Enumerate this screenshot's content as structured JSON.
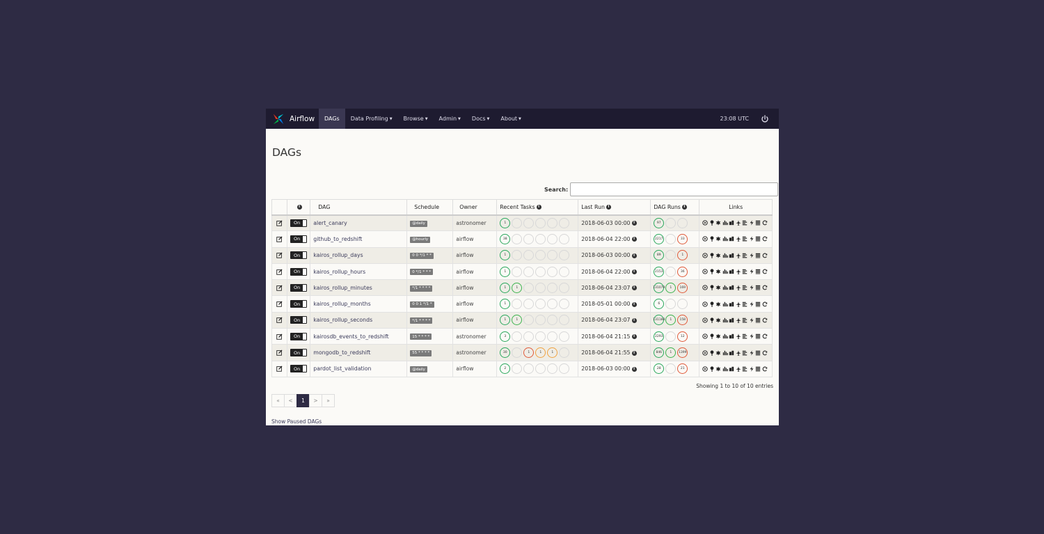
{
  "navbar": {
    "brand": "Airflow",
    "items": [
      {
        "label": "DAGs",
        "dropdown": false,
        "active": true
      },
      {
        "label": "Data Profiling",
        "dropdown": true
      },
      {
        "label": "Browse",
        "dropdown": true
      },
      {
        "label": "Admin",
        "dropdown": true
      },
      {
        "label": "Docs",
        "dropdown": true
      },
      {
        "label": "About",
        "dropdown": true
      }
    ],
    "clock": "23:08 UTC",
    "power_icon": "power-icon"
  },
  "page": {
    "title": "DAGs",
    "search_label": "Search:",
    "search_value": ""
  },
  "table": {
    "headers": [
      "",
      "",
      "DAG",
      "Schedule",
      "Owner",
      "Recent Tasks",
      "Last Run",
      "DAG Runs",
      "Links"
    ],
    "toggle_label": "On",
    "rows": [
      {
        "dag": "alert_canary",
        "schedule": "@daily",
        "owner": "astronomer",
        "tasks": [
          {
            "s": "success",
            "v": "1"
          },
          {
            "s": "",
            "v": ""
          },
          {
            "s": "",
            "v": ""
          },
          {
            "s": "",
            "v": ""
          },
          {
            "s": "",
            "v": ""
          },
          {
            "s": "",
            "v": ""
          }
        ],
        "last_run": "2018-06-03 00:00",
        "runs": [
          {
            "s": "success",
            "v": "97"
          },
          {
            "s": "",
            "v": ""
          },
          {
            "s": "",
            "v": ""
          }
        ]
      },
      {
        "dag": "github_to_redshift",
        "schedule": "@hourly",
        "owner": "airflow",
        "tasks": [
          {
            "s": "success",
            "v": "38"
          },
          {
            "s": "",
            "v": ""
          },
          {
            "s": "",
            "v": ""
          },
          {
            "s": "",
            "v": ""
          },
          {
            "s": "",
            "v": ""
          },
          {
            "s": "",
            "v": ""
          }
        ],
        "last_run": "2018-06-04 22:00",
        "runs": [
          {
            "s": "success",
            "v": "2217"
          },
          {
            "s": "",
            "v": ""
          },
          {
            "s": "failed",
            "v": "33"
          }
        ]
      },
      {
        "dag": "kairos_rollup_days",
        "schedule": "0 0 */1 * *",
        "owner": "airflow",
        "tasks": [
          {
            "s": "success",
            "v": "1"
          },
          {
            "s": "",
            "v": ""
          },
          {
            "s": "",
            "v": ""
          },
          {
            "s": "",
            "v": ""
          },
          {
            "s": "",
            "v": ""
          },
          {
            "s": "",
            "v": ""
          }
        ],
        "last_run": "2018-06-03 00:00",
        "runs": [
          {
            "s": "success",
            "v": "89"
          },
          {
            "s": "",
            "v": ""
          },
          {
            "s": "failed",
            "v": "1"
          }
        ]
      },
      {
        "dag": "kairos_rollup_hours",
        "schedule": "0 */1 * * *",
        "owner": "airflow",
        "tasks": [
          {
            "s": "success",
            "v": "1"
          },
          {
            "s": "",
            "v": ""
          },
          {
            "s": "",
            "v": ""
          },
          {
            "s": "",
            "v": ""
          },
          {
            "s": "",
            "v": ""
          },
          {
            "s": "",
            "v": ""
          }
        ],
        "last_run": "2018-06-04 22:00",
        "runs": [
          {
            "s": "success",
            "v": "2153"
          },
          {
            "s": "",
            "v": ""
          },
          {
            "s": "failed",
            "v": "36"
          }
        ]
      },
      {
        "dag": "kairos_rollup_minutes",
        "schedule": "*/1 * * * *",
        "owner": "airflow",
        "tasks": [
          {
            "s": "success",
            "v": "1"
          },
          {
            "s": "running",
            "v": "1"
          },
          {
            "s": "",
            "v": ""
          },
          {
            "s": "",
            "v": ""
          },
          {
            "s": "",
            "v": ""
          },
          {
            "s": "",
            "v": ""
          }
        ],
        "last_run": "2018-06-04 23:07",
        "runs": [
          {
            "s": "success",
            "v": "131079"
          },
          {
            "s": "running",
            "v": "1"
          },
          {
            "s": "failed",
            "v": "169"
          }
        ]
      },
      {
        "dag": "kairos_rollup_months",
        "schedule": "0 0 1 */1 *",
        "owner": "airflow",
        "tasks": [
          {
            "s": "success",
            "v": "1"
          },
          {
            "s": "",
            "v": ""
          },
          {
            "s": "",
            "v": ""
          },
          {
            "s": "",
            "v": ""
          },
          {
            "s": "",
            "v": ""
          },
          {
            "s": "",
            "v": ""
          }
        ],
        "last_run": "2018-05-01 00:00",
        "runs": [
          {
            "s": "success",
            "v": "6"
          },
          {
            "s": "",
            "v": ""
          },
          {
            "s": "",
            "v": ""
          }
        ]
      },
      {
        "dag": "kairos_rollup_seconds",
        "schedule": "*/1 * * * *",
        "owner": "airflow",
        "tasks": [
          {
            "s": "success",
            "v": "1"
          },
          {
            "s": "running",
            "v": "1"
          },
          {
            "s": "",
            "v": ""
          },
          {
            "s": "",
            "v": ""
          },
          {
            "s": "",
            "v": ""
          },
          {
            "s": "",
            "v": ""
          }
        ],
        "last_run": "2018-06-04 23:07",
        "runs": [
          {
            "s": "success",
            "v": "131188"
          },
          {
            "s": "running",
            "v": "1"
          },
          {
            "s": "failed",
            "v": "158"
          }
        ]
      },
      {
        "dag": "kairosdb_events_to_redshift",
        "schedule": "15 * * * *",
        "owner": "astronomer",
        "tasks": [
          {
            "s": "success",
            "v": "3"
          },
          {
            "s": "",
            "v": ""
          },
          {
            "s": "",
            "v": ""
          },
          {
            "s": "",
            "v": ""
          },
          {
            "s": "",
            "v": ""
          },
          {
            "s": "",
            "v": ""
          }
        ],
        "last_run": "2018-06-04 21:15",
        "runs": [
          {
            "s": "success",
            "v": "2293"
          },
          {
            "s": "",
            "v": ""
          },
          {
            "s": "failed",
            "v": "12"
          }
        ]
      },
      {
        "dag": "mongodb_to_redshift",
        "schedule": "55 * * * *",
        "owner": "astronomer",
        "tasks": [
          {
            "s": "success",
            "v": "30"
          },
          {
            "s": "",
            "v": ""
          },
          {
            "s": "failed",
            "v": "1"
          },
          {
            "s": "upstream",
            "v": "1"
          },
          {
            "s": "upstream",
            "v": "1"
          },
          {
            "s": "",
            "v": ""
          }
        ],
        "last_run": "2018-06-04 21:55",
        "runs": [
          {
            "s": "success",
            "v": "846"
          },
          {
            "s": "running",
            "v": "1"
          },
          {
            "s": "failed",
            "v": "1399"
          }
        ]
      },
      {
        "dag": "pardot_list_validation",
        "schedule": "@daily",
        "owner": "airflow",
        "tasks": [
          {
            "s": "success",
            "v": "2"
          },
          {
            "s": "",
            "v": ""
          },
          {
            "s": "",
            "v": ""
          },
          {
            "s": "",
            "v": ""
          },
          {
            "s": "",
            "v": ""
          },
          {
            "s": "",
            "v": ""
          }
        ],
        "last_run": "2018-06-03 00:00",
        "runs": [
          {
            "s": "success",
            "v": "28"
          },
          {
            "s": "",
            "v": ""
          },
          {
            "s": "failed",
            "v": "21"
          }
        ]
      }
    ],
    "link_icons": [
      "play-icon",
      "tree-icon",
      "graph-icon",
      "duration-icon",
      "tries-icon",
      "landing-times-icon",
      "gantt-icon",
      "code-icon",
      "logs-icon",
      "refresh-icon",
      "delete-icon"
    ]
  },
  "footer": {
    "showing": "Showing 1 to 10 of 10 entries",
    "pager": [
      "«",
      "<",
      "1",
      ">",
      "»"
    ],
    "active_page": "1",
    "show_paused": "Show Paused DAGs"
  },
  "colors": {
    "success": "#2aa85d",
    "failed": "#e05a3a",
    "upstream_failed": "#f0a240",
    "navbar": "#1e1b30"
  }
}
